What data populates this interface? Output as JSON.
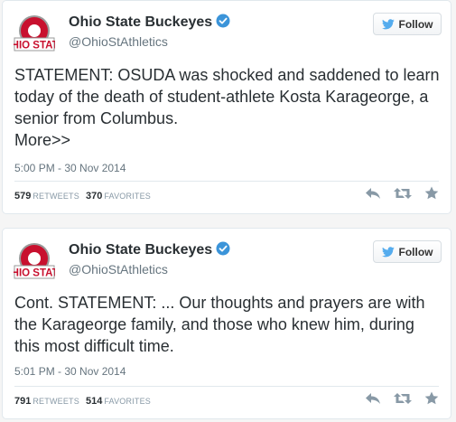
{
  "colors": {
    "logo_red": "#c8102e",
    "logo_gray": "#9a9a9a",
    "verified_blue": "#3b94d9",
    "twitter_blue": "#55acee",
    "action_gray": "#8899a6"
  },
  "tweets": [
    {
      "author_name": "Ohio State Buckeyes",
      "handle": "@OhioStAthletics",
      "follow_label": "Follow",
      "text": "STATEMENT: OSUDA was shocked and saddened to learn today of the death of student-athlete Kosta Karageorge, a senior from Columbus.",
      "more_label": "More>>",
      "timestamp": "5:00 PM - 30 Nov 2014",
      "retweets": "579",
      "retweets_label": "RETWEETS",
      "favorites": "370",
      "favorites_label": "FAVORITES"
    },
    {
      "author_name": "Ohio State Buckeyes",
      "handle": "@OhioStAthletics",
      "follow_label": "Follow",
      "text": "Cont. STATEMENT: ... Our thoughts and prayers are with the Karageorge family, and those who knew him, during this most difficult time.",
      "timestamp": "5:01 PM - 30 Nov 2014",
      "retweets": "791",
      "retweets_label": "RETWEETS",
      "favorites": "514",
      "favorites_label": "FAVORITES"
    }
  ],
  "icons": {
    "logo": "ohio-state-block-o-logo",
    "verified": "verified-badge-icon",
    "bird": "twitter-bird-icon",
    "reply": "reply-icon",
    "retweet": "retweet-icon",
    "favorite": "star-icon"
  }
}
